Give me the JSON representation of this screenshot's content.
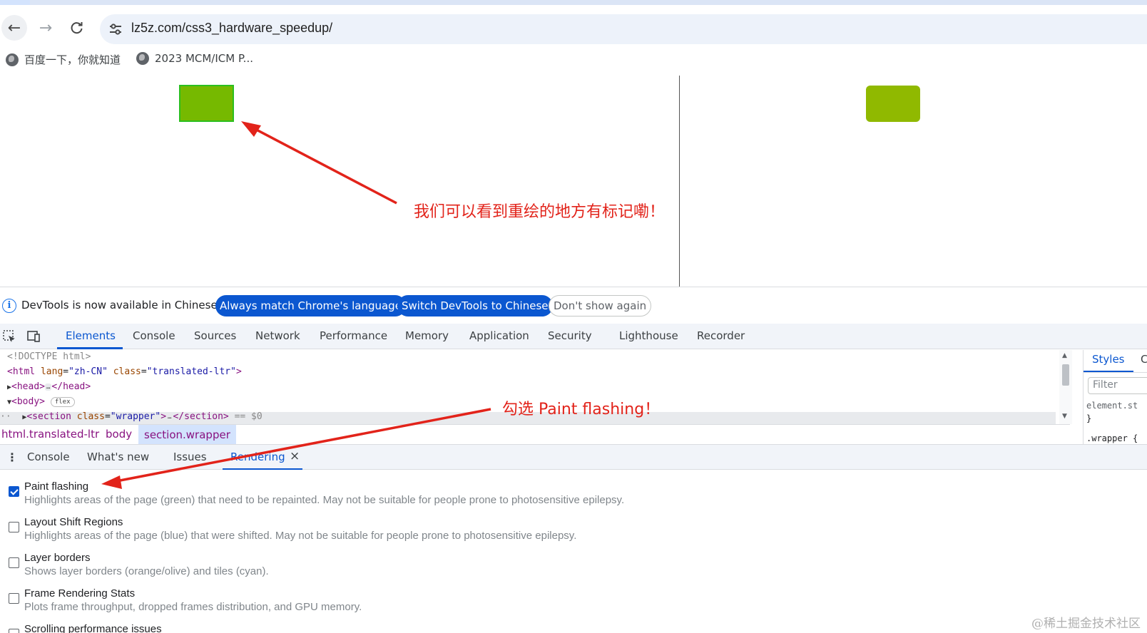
{
  "browser": {
    "url": "lz5z.com/css3_hardware_speedup/",
    "bookmarks": [
      "百度一下，你就知道",
      "2023 MCM/ICM P..."
    ]
  },
  "page": {
    "annotation_repaint": "我们可以看到重绘的地方有标记嘞！",
    "colors": {
      "box_left": "#76b900",
      "box_left_border": "#2bbf1f",
      "box_right": "#90b900"
    }
  },
  "devtools": {
    "infobar": {
      "message": "DevTools is now available in Chinese!",
      "always_match": "Always match Chrome's language",
      "switch": "Switch DevTools to Chinese",
      "dont_show": "Don't show again"
    },
    "tabs": [
      "Elements",
      "Console",
      "Sources",
      "Network",
      "Performance",
      "Memory",
      "Application",
      "Security",
      "Lighthouse",
      "Recorder"
    ],
    "active_tab": "Elements",
    "code": {
      "doctype": "<!DOCTYPE html>",
      "html_open": "<html",
      "lang_attr": "lang",
      "lang_val": "\"zh-CN\"",
      "class_attr": "class",
      "class_val": "\"translated-ltr\"",
      "close_bracket": ">",
      "head_open": "<head>",
      "head_close": "</head>",
      "body_open": "<body>",
      "body_badge": "flex",
      "section_open": "<section",
      "section_class_val": "\"wrapper\"",
      "section_close": "</section>",
      "eq0": "== $0",
      "ellipsis": "…"
    },
    "breadcrumbs": [
      "html.translated-ltr",
      "body",
      "section.wrapper"
    ],
    "styles": {
      "tab": "Styles",
      "tab2": "C",
      "filter_placeholder": "Filter",
      "rule1": "element.st",
      "brace_close": "}",
      "rule2": ".wrapper {"
    },
    "drawer": {
      "tabs": [
        "Console",
        "What's new",
        "Issues",
        "Rendering"
      ],
      "active": "Rendering",
      "close": "×"
    },
    "rendering_options": [
      {
        "title": "Paint flashing",
        "desc": "Highlights areas of the page (green) that need to be repainted. May not be suitable for people prone to photosensitive epilepsy.",
        "checked": true
      },
      {
        "title": "Layout Shift Regions",
        "desc": "Highlights areas of the page (blue) that were shifted. May not be suitable for people prone to photosensitive epilepsy.",
        "checked": false
      },
      {
        "title": "Layer borders",
        "desc": "Shows layer borders (orange/olive) and tiles (cyan).",
        "checked": false
      },
      {
        "title": "Frame Rendering Stats",
        "desc": "Plots frame throughput, dropped frames distribution, and GPU memory.",
        "checked": false
      },
      {
        "title": "Scrolling performance issues",
        "desc": "",
        "checked": false
      }
    ],
    "annotation_check": "勾选 Paint flashing！"
  },
  "watermark": "@稀土掘金技术社区"
}
